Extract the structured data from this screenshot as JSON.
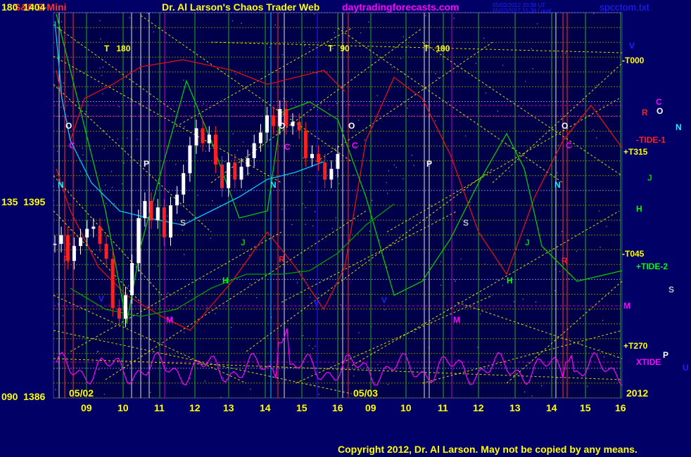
{
  "header": {
    "symbol": "S&P E-Mini",
    "title": "Dr. Al Larson's Chaos Trader Web",
    "site": "daytradingforecasts.com",
    "file": "spcctom.txt",
    "stamp1": "05/02/2012 20:38 UT",
    "stamp2": "05/02/2012 15:38 Local"
  },
  "y_labels": [
    {
      "angle": "180",
      "price": "1404"
    },
    {
      "angle": "135",
      "price": "1395"
    },
    {
      "angle": "090",
      "price": "1386"
    }
  ],
  "dates": [
    "05/02",
    "05/03"
  ],
  "year": "2012",
  "x_ticks": [
    "09",
    "10",
    "11",
    "12",
    "13",
    "14",
    "15",
    "16",
    "09",
    "10",
    "11",
    "12",
    "13",
    "14",
    "15",
    "16"
  ],
  "level_labels": [
    {
      "text": "-T000",
      "color": "#ffff00"
    },
    {
      "text": "-TIDE-1",
      "color": "#ff2020"
    },
    {
      "text": "+T315",
      "color": "#ffff00"
    },
    {
      "text": "-T045",
      "color": "#ffff00"
    },
    {
      "text": "+TIDE-2",
      "color": "#00ff00"
    },
    {
      "text": "+T270",
      "color": "#ffff00"
    },
    {
      "text": "XTIDE",
      "color": "#ff00ff"
    }
  ],
  "time_marks": [
    {
      "t": "T",
      "deg": "180"
    },
    {
      "t": "T",
      "deg": "90"
    },
    {
      "t": "T",
      "deg": "180"
    }
  ],
  "planet_letters": [
    {
      "c": "V",
      "color": "#2020ff"
    },
    {
      "c": "C",
      "color": "#ff00ff"
    },
    {
      "c": "R",
      "color": "#ff2020"
    },
    {
      "c": "O",
      "color": "#ffffff"
    },
    {
      "c": "N",
      "color": "#00ffff"
    },
    {
      "c": "J",
      "color": "#00cc00"
    },
    {
      "c": "H",
      "color": "#00ff00"
    },
    {
      "c": "S",
      "color": "#c0c0c0"
    },
    {
      "c": "M",
      "color": "#ff00ff"
    },
    {
      "c": "P",
      "color": "#ffffff"
    },
    {
      "c": "U",
      "color": "#2020ff"
    }
  ],
  "copyright": "Copyright 2012, Dr. Al Larson. May not be copied by any means.",
  "chart_data": {
    "type": "candlestick",
    "title": "S&P E-Mini",
    "y_range": [
      1386,
      1404
    ],
    "x_range": [
      "05/02 08:00",
      "05/03 16:00"
    ],
    "price_series": [
      {
        "name": "S&P E-Mini",
        "values": [
          1393.2,
          1393.6,
          1392.4,
          1393.1,
          1393.5,
          1393.9,
          1394.0,
          1393.2,
          1392.5,
          1390.2,
          1389.7,
          1390.8,
          1392.3,
          1394.4,
          1395.2,
          1394.3,
          1394.9,
          1393.5,
          1395.0,
          1395.5,
          1396.5,
          1397.8,
          1398.6,
          1397.9,
          1398.3,
          1396.9,
          1395.8,
          1397.0,
          1396.2,
          1396.8,
          1397.2,
          1397.9,
          1398.4,
          1399.2,
          1398.7,
          1399.5,
          1398.7,
          1398.9,
          1398.5,
          1397.2,
          1397.4,
          1397.0,
          1396.2,
          1396.7,
          1397.4
        ]
      }
    ],
    "lines": [
      {
        "name": "red-cycle",
        "color": "#e01010"
      },
      {
        "name": "green-cycle",
        "color": "#00cc00"
      },
      {
        "name": "cyan-line",
        "color": "#00c8ff"
      },
      {
        "name": "magenta-xtide",
        "color": "#ff00ff"
      }
    ]
  }
}
